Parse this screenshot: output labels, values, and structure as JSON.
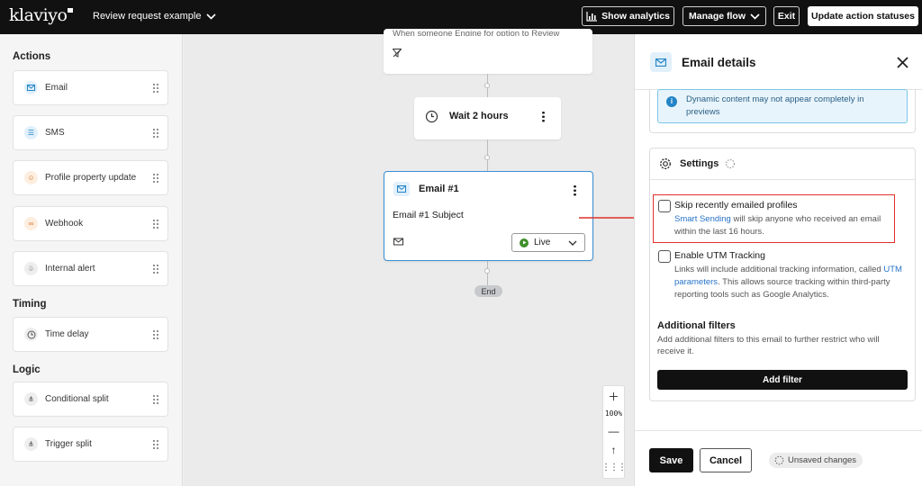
{
  "topbar": {
    "logo": "klaviyo",
    "flow_name": "Review request example",
    "show_analytics": "Show analytics",
    "manage_flow": "Manage flow",
    "exit": "Exit",
    "update_statuses": "Update action statuses"
  },
  "sidebar": {
    "actions_title": "Actions",
    "actions": [
      {
        "label": "Email",
        "icon": "email-icon"
      },
      {
        "label": "SMS",
        "icon": "sms-icon"
      },
      {
        "label": "Profile property update",
        "icon": "profile-icon"
      },
      {
        "label": "Webhook",
        "icon": "webhook-icon"
      },
      {
        "label": "Internal alert",
        "icon": "bell-icon"
      }
    ],
    "timing_title": "Timing",
    "timing": [
      {
        "label": "Time delay",
        "icon": "clock-icon"
      }
    ],
    "logic_title": "Logic",
    "logic": [
      {
        "label": "Conditional split",
        "icon": "split-icon"
      },
      {
        "label": "Trigger split",
        "icon": "trigger-split-icon"
      }
    ]
  },
  "canvas": {
    "trigger_text": "When someone Engine for option to Review",
    "wait_label": "Wait 2 hours",
    "email_title": "Email #1",
    "email_subject": "Email #1 Subject",
    "status": "Live",
    "end_label": "End",
    "zoom_level": "100%"
  },
  "panel": {
    "title": "Email details",
    "info_text": "Dynamic content may not appear completely in previews",
    "settings_title": "Settings",
    "skip_label": "Skip recently emailed profiles",
    "skip_link": "Smart Sending",
    "skip_desc": " will skip anyone who received an email within the last 16 hours.",
    "utm_label": "Enable UTM Tracking",
    "utm_desc_1": "Links will include additional tracking information, called ",
    "utm_link": "UTM parameters",
    "utm_desc_2": ". This allows source tracking within third-party reporting tools such as Google Analytics.",
    "filters_title": "Additional filters",
    "filters_desc": "Add additional filters to this email to further restrict who will receive it.",
    "add_filter": "Add filter",
    "save": "Save",
    "cancel": "Cancel",
    "unsaved": "Unsaved changes"
  },
  "colors": {
    "highlight": "#e0302a",
    "live_green": "#3f8f2a",
    "link_blue": "#2773c7",
    "selected_border": "#3a8fd6"
  }
}
